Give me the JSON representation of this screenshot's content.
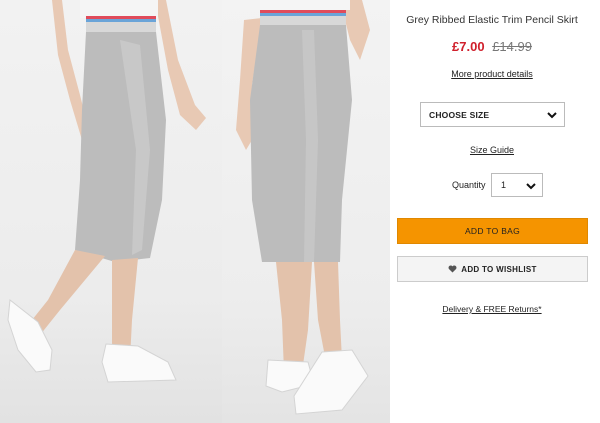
{
  "images": {
    "front": {
      "name": "product-photo-front"
    },
    "back": {
      "name": "product-photo-back"
    }
  },
  "product": {
    "title": "Grey Ribbed Elastic Trim Pencil Skirt",
    "price_now": "£7.00",
    "price_was": "£14.99",
    "more_details": "More product details"
  },
  "size": {
    "selected": "CHOOSE SIZE",
    "guide": "Size Guide"
  },
  "quantity": {
    "label": "Quantity",
    "selected": "1"
  },
  "actions": {
    "add_to_bag": "ADD TO BAG",
    "add_to_wishlist": "ADD TO WISHLIST"
  },
  "footer": {
    "delivery": "Delivery & FREE Returns*"
  },
  "colors": {
    "price_red": "#d0202c",
    "bag_orange": "#f59400",
    "skirt_grey": "#b9b9b9"
  },
  "icons": {
    "dropdown": "chevron-down-icon",
    "wishlist": "heart-icon"
  }
}
